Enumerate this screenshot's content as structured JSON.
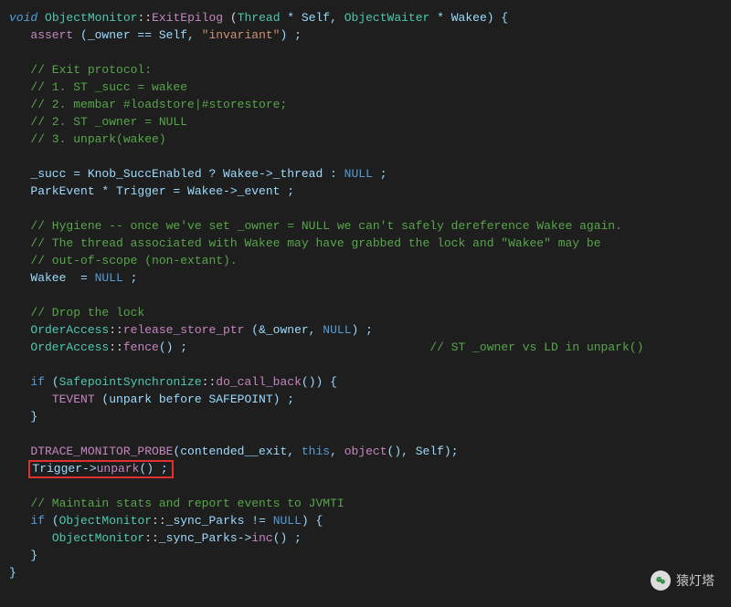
{
  "code": {
    "l0": {
      "kw": "void",
      "cls": "ObjectMonitor",
      "sep": "::",
      "fn": "ExitEpilog",
      "op": " (",
      "t1": "Thread",
      "a1": " * Self, ",
      "t2": "ObjectWaiter",
      "a2": " * Wakee) {"
    },
    "l1": {
      "indent": "   ",
      "fn": "assert",
      "rest": " (_owner == Self, ",
      "str": "\"invariant\"",
      "close": ") ;"
    },
    "l2": "",
    "l3": {
      "indent": "   ",
      "cmt": "// Exit protocol:"
    },
    "l4": {
      "indent": "   ",
      "cmt": "// 1. ST _succ = wakee"
    },
    "l5": {
      "indent": "   ",
      "cmt": "// 2. membar #loadstore|#storestore;"
    },
    "l6": {
      "indent": "   ",
      "cmt": "// 2. ST _owner = NULL"
    },
    "l7": {
      "indent": "   ",
      "cmt": "// 3. unpark(wakee)"
    },
    "l8": "",
    "l9": {
      "indent": "   ",
      "a": "_succ = Knob_SuccEnabled ? Wakee->_thread : ",
      "kw": "NULL",
      "b": " ;"
    },
    "l10": {
      "indent": "   ",
      "a": "ParkEvent * Trigger = Wakee->_event ;"
    },
    "l11": "",
    "l12": {
      "indent": "   ",
      "cmt": "// Hygiene -- once we've set _owner = NULL we can't safely dereference Wakee again."
    },
    "l13": {
      "indent": "   ",
      "cmt": "// The thread associated with Wakee may have grabbed the lock and \"Wakee\" may be"
    },
    "l14": {
      "indent": "   ",
      "cmt": "// out-of-scope (non-extant)."
    },
    "l15": {
      "indent": "   ",
      "a": "Wakee  = ",
      "kw": "NULL",
      "b": " ;"
    },
    "l16": "",
    "l17": {
      "indent": "   ",
      "cmt": "// Drop the lock"
    },
    "l18": {
      "indent": "   ",
      "cls": "OrderAccess",
      "sep": "::",
      "fn": "release_store_ptr",
      "rest": " (&_owner, ",
      "kw": "NULL",
      "close": ") ;"
    },
    "l19": {
      "indent": "   ",
      "cls": "OrderAccess",
      "sep": "::",
      "fn": "fence",
      "rest": "() ;",
      "pad": "                                  ",
      "cmt": "// ST _owner vs LD in unpark()"
    },
    "l20": "",
    "l21": {
      "indent": "   ",
      "kw": "if",
      "a": " (",
      "cls": "SafepointSynchronize",
      "sep": "::",
      "fn": "do_call_back",
      "b": "()) {"
    },
    "l22": {
      "indent": "      ",
      "fn": "TEVENT",
      "rest": " (unpark before SAFEPOINT) ;"
    },
    "l23": {
      "indent": "   ",
      "a": "}"
    },
    "l24": "",
    "l25": {
      "indent": "   ",
      "fn": "DTRACE_MONITOR_PROBE",
      "a": "(contended__exit, ",
      "kw": "this",
      "b": ", ",
      "fn2": "object",
      "c": "(), Self);"
    },
    "l26": {
      "indent": "   ",
      "a": "Trigger->",
      "fn": "unpark",
      "b": "() ;"
    },
    "l27": "",
    "l28": {
      "indent": "   ",
      "cmt": "// Maintain stats and report events to JVMTI"
    },
    "l29": {
      "indent": "   ",
      "kw": "if",
      "a": " (",
      "cls": "ObjectMonitor",
      "sep": "::",
      "id": "_sync_Parks",
      "b": " != ",
      "kw2": "NULL",
      "c": ") {"
    },
    "l30": {
      "indent": "      ",
      "cls": "ObjectMonitor",
      "sep": "::",
      "id": "_sync_Parks",
      "a": "->",
      "fn": "inc",
      "b": "() ;"
    },
    "l31": {
      "indent": "   ",
      "a": "}"
    },
    "l32": {
      "a": "}"
    }
  },
  "watermark": {
    "text": "猿灯塔"
  }
}
